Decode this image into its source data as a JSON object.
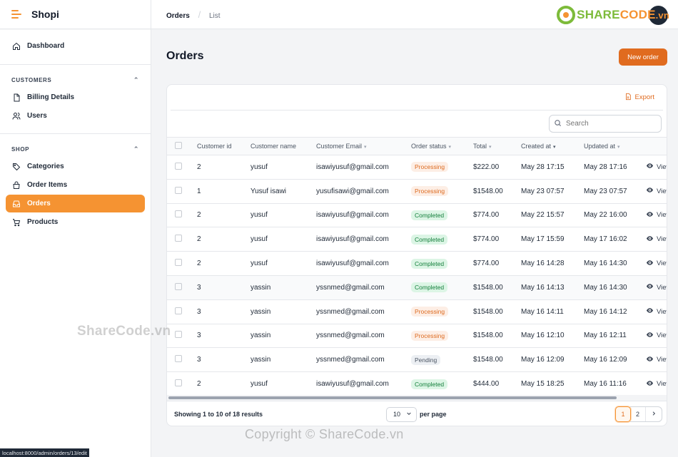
{
  "app": {
    "title": "Shopi"
  },
  "sidebar": {
    "dashboard": "Dashboard",
    "groups": [
      {
        "label": "CUSTOMERS",
        "items": [
          {
            "label": "Billing Details",
            "icon": "file-icon"
          },
          {
            "label": "Users",
            "icon": "users-icon"
          }
        ]
      },
      {
        "label": "SHOP",
        "items": [
          {
            "label": "Categories",
            "icon": "tag-icon"
          },
          {
            "label": "Order Items",
            "icon": "bag-icon"
          },
          {
            "label": "Orders",
            "icon": "inbox-icon",
            "active": true
          },
          {
            "label": "Products",
            "icon": "cart-icon"
          }
        ]
      }
    ]
  },
  "breadcrumb": {
    "parent": "Orders",
    "current": "List"
  },
  "watermark": {
    "logo_text_a": "SHARE",
    "logo_text_b": "CODE",
    "logo_suffix": ".vn",
    "mid": "ShareCode.vn",
    "bottom": "Copyright © ShareCode.vn"
  },
  "page": {
    "title": "Orders",
    "new_button": "New order"
  },
  "toolbar": {
    "export": "Export",
    "search_placeholder": "Search"
  },
  "table": {
    "columns": [
      "Customer id",
      "Customer name",
      "Customer Email",
      "Order status",
      "Total",
      "Created at",
      "Updated at",
      ""
    ],
    "view_label": "View",
    "rows": [
      {
        "id": "2",
        "name": "yusuf",
        "email": "isawiyusuf@gmail.com",
        "status": "Processing",
        "total": "$222.00",
        "created": "May 28 17:15",
        "updated": "May 28 17:16"
      },
      {
        "id": "1",
        "name": "Yusuf isawi",
        "email": "yusufisawi@gmail.com",
        "status": "Processing",
        "total": "$1548.00",
        "created": "May 23 07:57",
        "updated": "May 23 07:57"
      },
      {
        "id": "2",
        "name": "yusuf",
        "email": "isawiyusuf@gmail.com",
        "status": "Completed",
        "total": "$774.00",
        "created": "May 22 15:57",
        "updated": "May 22 16:00"
      },
      {
        "id": "2",
        "name": "yusuf",
        "email": "isawiyusuf@gmail.com",
        "status": "Completed",
        "total": "$774.00",
        "created": "May 17 15:59",
        "updated": "May 17 16:02"
      },
      {
        "id": "2",
        "name": "yusuf",
        "email": "isawiyusuf@gmail.com",
        "status": "Completed",
        "total": "$774.00",
        "created": "May 16 14:28",
        "updated": "May 16 14:30"
      },
      {
        "id": "3",
        "name": "yassin",
        "email": "yssnmed@gmail.com",
        "status": "Completed",
        "total": "$1548.00",
        "created": "May 16 14:13",
        "updated": "May 16 14:30"
      },
      {
        "id": "3",
        "name": "yassin",
        "email": "yssnmed@gmail.com",
        "status": "Processing",
        "total": "$1548.00",
        "created": "May 16 14:11",
        "updated": "May 16 14:12"
      },
      {
        "id": "3",
        "name": "yassin",
        "email": "yssnmed@gmail.com",
        "status": "Processing",
        "total": "$1548.00",
        "created": "May 16 12:10",
        "updated": "May 16 12:11"
      },
      {
        "id": "3",
        "name": "yassin",
        "email": "yssnmed@gmail.com",
        "status": "Pending",
        "total": "$1548.00",
        "created": "May 16 12:09",
        "updated": "May 16 12:09"
      },
      {
        "id": "2",
        "name": "yusuf",
        "email": "isawiyusuf@gmail.com",
        "status": "Completed",
        "total": "$444.00",
        "created": "May 15 18:25",
        "updated": "May 16 11:16"
      }
    ]
  },
  "footer": {
    "results": "Showing 1 to 10 of 18 results",
    "per_page_value": "10",
    "per_page_label": "per page",
    "pages": [
      "1",
      "2"
    ],
    "current_page": "1"
  },
  "status_bar": {
    "url": "localhost:8000/admin/orders/13/edit"
  },
  "colors": {
    "accent": "#f59332",
    "button": "#e06b1f",
    "processing": "#dd6b20",
    "completed": "#15803d"
  }
}
